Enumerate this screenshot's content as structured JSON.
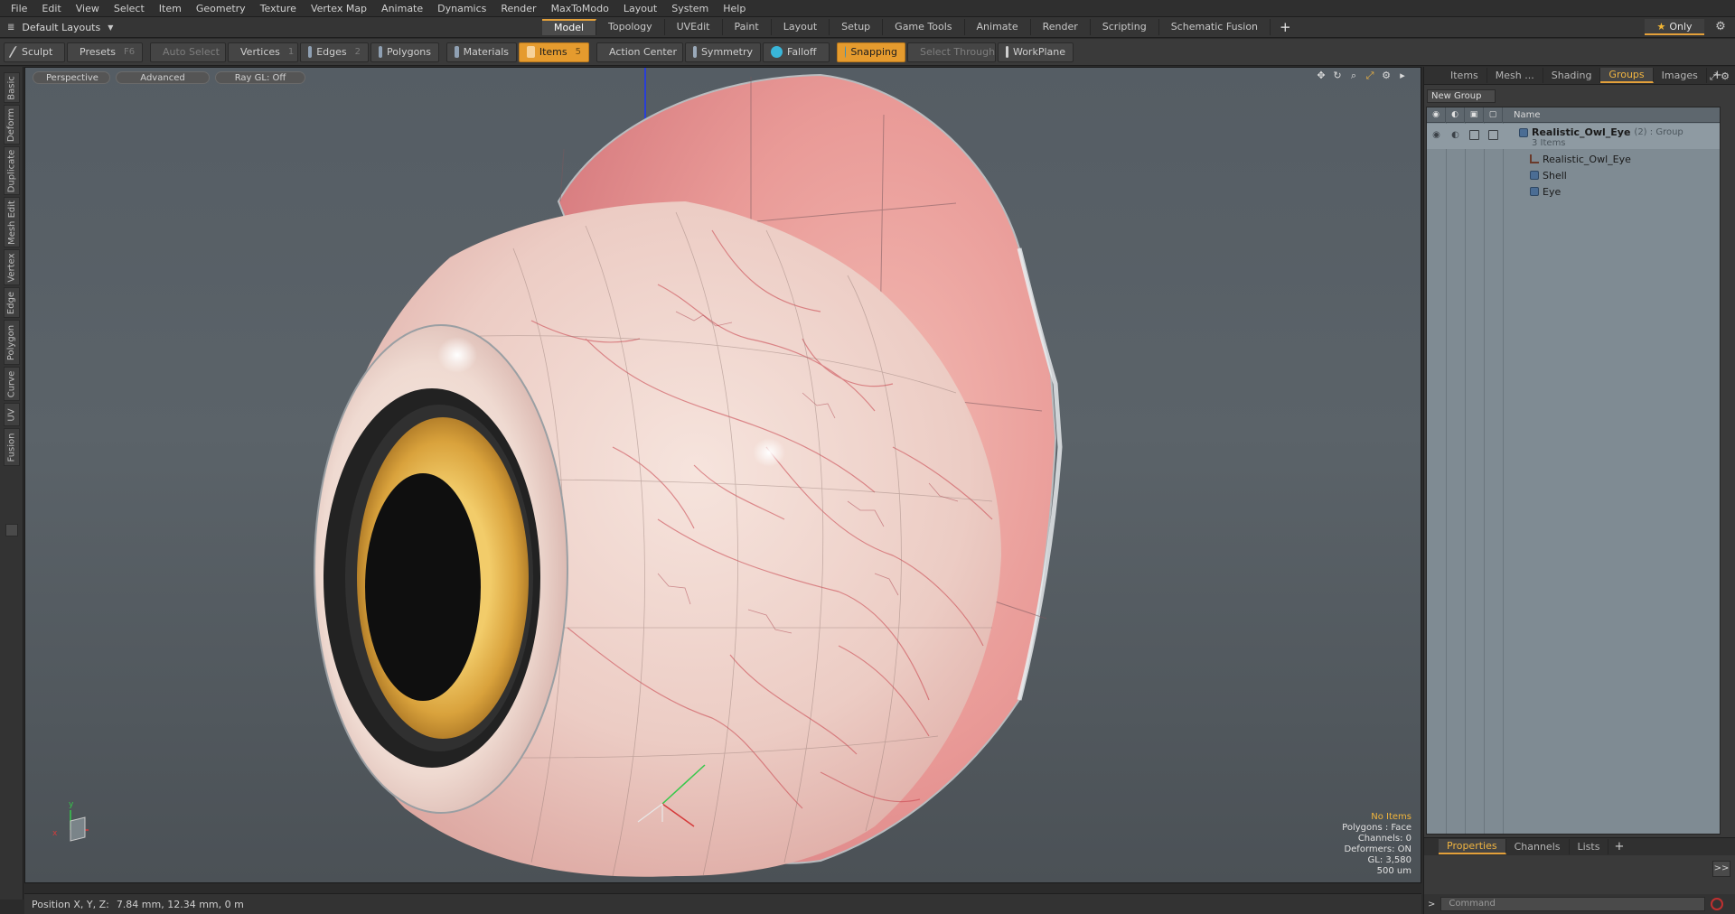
{
  "menu": [
    "File",
    "Edit",
    "View",
    "Select",
    "Item",
    "Geometry",
    "Texture",
    "Vertex Map",
    "Animate",
    "Dynamics",
    "Render",
    "MaxToModo",
    "Layout",
    "System",
    "Help"
  ],
  "layout_selector": "Default Layouts",
  "tabs": [
    "Model",
    "Topology",
    "UVEdit",
    "Paint",
    "Layout",
    "Setup",
    "Game Tools",
    "Animate",
    "Render",
    "Scripting",
    "Schematic Fusion"
  ],
  "active_tab": "Model",
  "only_label": "Only",
  "toolbar": {
    "sculpt": "Sculpt",
    "presets": "Presets",
    "presets_key": "F6",
    "auto_select": "Auto Select",
    "vertices": "Vertices",
    "vertices_key": "1",
    "edges": "Edges",
    "edges_key": "2",
    "polygons": "Polygons",
    "materials": "Materials",
    "items": "Items",
    "items_key": "5",
    "action_center": "Action Center",
    "symmetry": "Symmetry",
    "falloff": "Falloff",
    "snapping": "Snapping",
    "select_through": "Select Through",
    "workplane": "WorkPlane"
  },
  "left_tabs": [
    "Basic",
    "Deform",
    "Duplicate",
    "Mesh Edit",
    "Vertex",
    "Edge",
    "Polygon",
    "Curve",
    "UV",
    "Fusion"
  ],
  "viewport": {
    "view": "Perspective",
    "shading": "Advanced",
    "raygl": "Ray GL: Off",
    "info": {
      "no_items": "No Items",
      "polygons": "Polygons : Face",
      "channels": "Channels: 0",
      "deformers": "Deformers: ON",
      "gl": "GL: 3,580",
      "scale": "500 um"
    },
    "axis_y": "y",
    "axis_x": "x"
  },
  "status": {
    "label": "Position X, Y, Z:",
    "value": "7.84 mm, 12.34 mm, 0 m"
  },
  "right_panel": {
    "tabs": [
      "Items",
      "Mesh ...",
      "Shading",
      "Groups",
      "Images"
    ],
    "active_tab": "Groups",
    "new_group": "New Group",
    "name_header": "Name",
    "tree": {
      "group_name": "Realistic_Owl_Eye",
      "group_suffix": "(2) : Group",
      "group_count": "3 Items",
      "children": [
        "Realistic_Owl_Eye",
        "Shell",
        "Eye"
      ]
    },
    "bottom_tabs": [
      "Properties",
      "Channels",
      "Lists"
    ],
    "active_bottom_tab": "Properties",
    "props_arrow": ">>",
    "command_placeholder": "Command"
  },
  "colors": {
    "accent": "#e3a03a",
    "sclera": "#f1dcd4",
    "iris": "#e4b04a",
    "pupil": "#111111",
    "vein": "#c8404a"
  }
}
